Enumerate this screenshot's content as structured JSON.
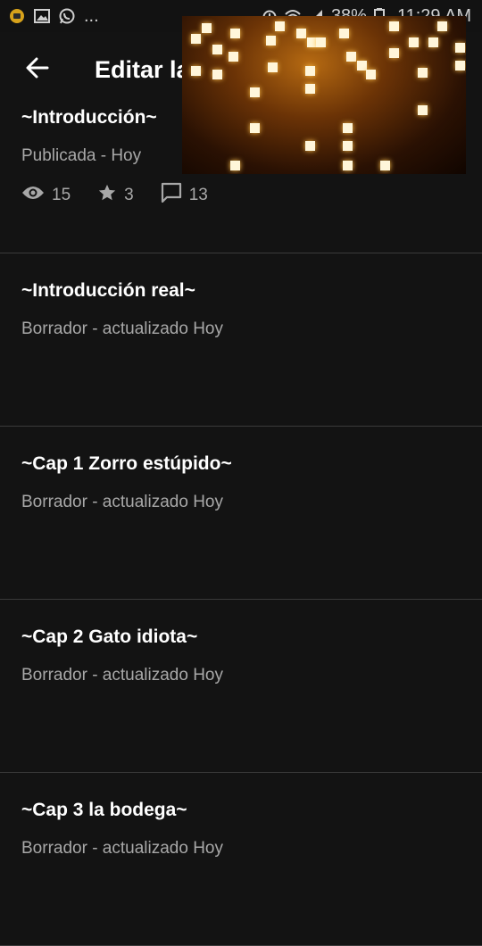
{
  "status_bar": {
    "left_more": "...",
    "battery": "38%",
    "time": "11:29 AM",
    "icons": [
      "notification-icon",
      "image-icon",
      "whatsapp-icon",
      "alarm-icon",
      "wifi-icon",
      "signal-icon",
      "battery-icon"
    ]
  },
  "header": {
    "title": "Editar la"
  },
  "overlay": {
    "description_icon": "pixel-glow-overlay"
  },
  "parts": [
    {
      "title": "~Introducción~",
      "status": "Publicada - Hoy",
      "stats": {
        "views": "15",
        "votes": "3",
        "comments": "13"
      }
    },
    {
      "title": "~Introducción real~",
      "status": "Borrador - actualizado Hoy"
    },
    {
      "title": "~Cap 1 Zorro estúpido~",
      "status": "Borrador - actualizado Hoy"
    },
    {
      "title": "~Cap 2 Gato idiota~",
      "status": "Borrador - actualizado Hoy"
    },
    {
      "title": "~Cap 3 la bodega~",
      "status": "Borrador - actualizado Hoy"
    }
  ],
  "colors": {
    "background": "#131313",
    "divider": "#3a3a3a",
    "text_primary": "#ffffff",
    "text_secondary": "#a8a8a8"
  }
}
